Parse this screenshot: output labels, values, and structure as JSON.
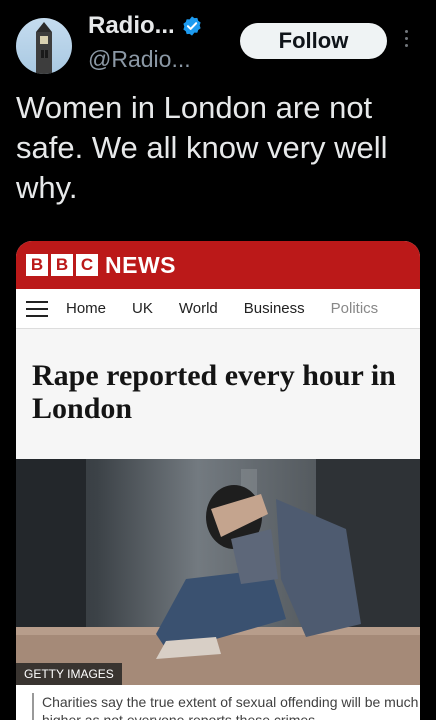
{
  "tweet": {
    "display_name": "Radio...",
    "handle": "@Radio...",
    "follow_label": "Follow",
    "text": "Women in London are not safe. We all know very well why."
  },
  "bbc": {
    "letters": [
      "B",
      "B",
      "C"
    ],
    "news_label": "NEWS",
    "nav": [
      "Home",
      "UK",
      "World",
      "Business",
      "Politics"
    ],
    "headline": "Rape reported every hour in London",
    "image_credit": "GETTY IMAGES",
    "caption": "Charities say the true extent of sexual offending will be much higher as not everyone reports these crimes"
  },
  "colors": {
    "bbc_red": "#bb1919",
    "verified_blue": "#1d9bf0",
    "follow_bg": "#eff3f4"
  }
}
